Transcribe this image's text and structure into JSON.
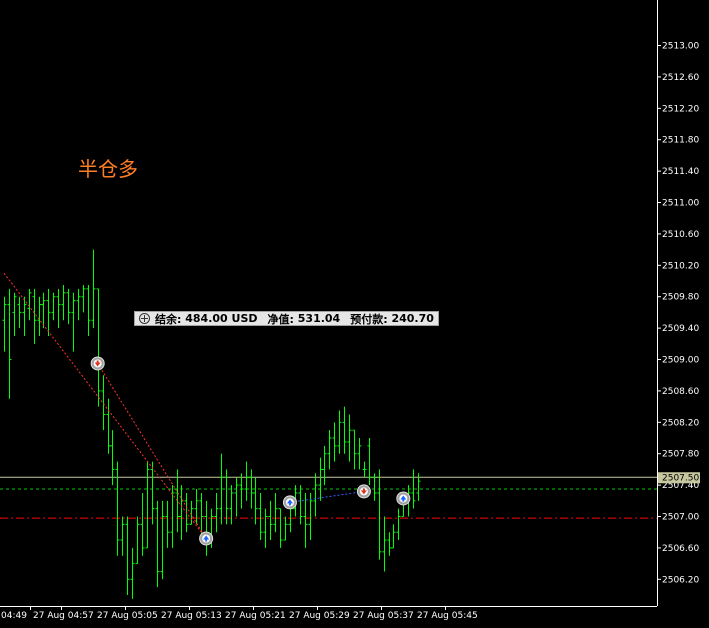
{
  "colors": {
    "background": "#000000",
    "axis": "#ffffff",
    "bar": "#00ff00",
    "bid_line": "#c8c8a0",
    "level_green": "#00c800",
    "level_red": "#ff0000",
    "trend_red": "#ff3030",
    "annotation": "#ff7f27",
    "price_tag_bg": "#c8c8a0"
  },
  "annotation_text": "半仓多",
  "account": {
    "balance_label": "结余:",
    "balance_value": "484.00 USD",
    "equity_label": "净值:",
    "equity_value": "531.04",
    "margin_label": "预付款:",
    "margin_value": "240.70"
  },
  "chart_data": {
    "type": "bar",
    "title": "",
    "xlabel": "",
    "ylabel": "",
    "ylim": [
      2505.86,
      2513.58
    ],
    "y_ticks": [
      "2513.00",
      "2512.60",
      "2512.20",
      "2511.80",
      "2511.40",
      "2511.00",
      "2510.60",
      "2510.20",
      "2509.80",
      "2509.40",
      "2509.00",
      "2508.60",
      "2508.20",
      "2507.80",
      "2507.40",
      "2507.00",
      "2506.60",
      "2506.20"
    ],
    "x_ticks": [
      "04:49",
      "27 Aug 04:57",
      "27 Aug 05:05",
      "27 Aug 05:13",
      "27 Aug 05:21",
      "27 Aug 05:29",
      "27 Aug 05:37",
      "27 Aug 05:45"
    ],
    "current_price": "2507.50",
    "level_lines": {
      "green_dashed": 2507.35,
      "red_dashdot": 2506.98
    },
    "bars": [
      [
        2509.8,
        2509.1,
        2509.5,
        2509.7
      ],
      [
        2509.9,
        2508.5,
        2509.7,
        2509.0
      ],
      [
        2509.85,
        2509.3,
        2509.6,
        2509.8
      ],
      [
        2509.8,
        2509.4,
        2509.7,
        2509.6
      ],
      [
        2509.8,
        2509.3,
        2509.6,
        2509.7
      ],
      [
        2509.9,
        2509.5,
        2509.65,
        2509.85
      ],
      [
        2509.9,
        2509.2,
        2509.8,
        2509.5
      ],
      [
        2509.8,
        2509.3,
        2509.5,
        2509.7
      ],
      [
        2509.85,
        2509.4,
        2509.7,
        2509.75
      ],
      [
        2509.9,
        2509.3,
        2509.75,
        2509.6
      ],
      [
        2509.85,
        2509.5,
        2509.6,
        2509.8
      ],
      [
        2509.9,
        2509.4,
        2509.8,
        2509.7
      ],
      [
        2509.95,
        2509.5,
        2509.7,
        2509.85
      ],
      [
        2509.9,
        2509.45,
        2509.85,
        2509.6
      ],
      [
        2509.85,
        2509.1,
        2509.6,
        2509.75
      ],
      [
        2509.9,
        2509.5,
        2509.75,
        2509.8
      ],
      [
        2509.95,
        2509.6,
        2509.8,
        2509.9
      ],
      [
        2509.95,
        2509.3,
        2509.9,
        2509.5
      ],
      [
        2510.4,
        2509.4,
        2509.5,
        2509.9
      ],
      [
        2509.9,
        2508.4,
        2509.9,
        2508.6
      ],
      [
        2508.8,
        2508.1,
        2508.6,
        2508.3
      ],
      [
        2508.5,
        2507.8,
        2508.3,
        2507.9
      ],
      [
        2508.1,
        2507.4,
        2507.9,
        2507.6
      ],
      [
        2507.7,
        2506.5,
        2507.6,
        2506.7
      ],
      [
        2507.0,
        2506.5,
        2506.7,
        2506.9
      ],
      [
        2507.0,
        2506.0,
        2506.9,
        2506.2
      ],
      [
        2506.6,
        2505.95,
        2506.2,
        2506.4
      ],
      [
        2507.0,
        2506.4,
        2506.4,
        2506.9
      ],
      [
        2507.3,
        2506.5,
        2506.9,
        2506.6
      ],
      [
        2507.7,
        2506.6,
        2506.6,
        2507.6
      ],
      [
        2507.7,
        2506.9,
        2507.6,
        2507.1
      ],
      [
        2507.2,
        2506.1,
        2507.1,
        2506.3
      ],
      [
        2507.2,
        2506.2,
        2506.3,
        2507.0
      ],
      [
        2507.2,
        2506.6,
        2507.0,
        2506.8
      ],
      [
        2507.4,
        2506.6,
        2506.8,
        2507.3
      ],
      [
        2507.6,
        2506.8,
        2507.3,
        2507.0
      ],
      [
        2507.4,
        2506.7,
        2507.0,
        2507.2
      ],
      [
        2507.3,
        2506.8,
        2507.2,
        2506.9
      ],
      [
        2507.2,
        2506.9,
        2506.9,
        2507.1
      ],
      [
        2507.35,
        2506.9,
        2507.1,
        2507.2
      ],
      [
        2507.3,
        2506.7,
        2507.2,
        2507.0
      ],
      [
        2507.2,
        2506.5,
        2507.0,
        2506.7
      ],
      [
        2507.1,
        2506.6,
        2506.7,
        2507.0
      ],
      [
        2507.3,
        2506.8,
        2507.0,
        2507.1
      ],
      [
        2507.8,
        2506.9,
        2507.1,
        2507.5
      ],
      [
        2507.6,
        2506.9,
        2507.5,
        2507.1
      ],
      [
        2507.4,
        2506.9,
        2507.1,
        2507.3
      ],
      [
        2507.5,
        2507.0,
        2507.3,
        2507.4
      ],
      [
        2507.55,
        2507.1,
        2507.4,
        2507.35
      ],
      [
        2507.7,
        2507.2,
        2507.35,
        2507.5
      ],
      [
        2507.6,
        2507.1,
        2507.5,
        2507.3
      ],
      [
        2507.5,
        2506.9,
        2507.3,
        2507.1
      ],
      [
        2507.3,
        2506.7,
        2507.1,
        2506.8
      ],
      [
        2507.1,
        2506.6,
        2506.8,
        2507.0
      ],
      [
        2507.2,
        2506.7,
        2507.0,
        2506.9
      ],
      [
        2507.3,
        2506.8,
        2506.9,
        2507.1
      ],
      [
        2507.1,
        2506.6,
        2507.1,
        2506.7
      ],
      [
        2507.0,
        2506.7,
        2506.7,
        2506.9
      ],
      [
        2507.2,
        2506.8,
        2506.9,
        2507.1
      ],
      [
        2507.4,
        2507.0,
        2507.1,
        2507.3
      ],
      [
        2507.4,
        2506.9,
        2507.3,
        2507.0
      ],
      [
        2507.3,
        2506.6,
        2507.0,
        2506.9
      ],
      [
        2507.3,
        2506.7,
        2506.9,
        2507.2
      ],
      [
        2507.55,
        2507.0,
        2507.2,
        2507.4
      ],
      [
        2507.75,
        2507.2,
        2507.4,
        2507.6
      ],
      [
        2507.9,
        2507.4,
        2507.6,
        2507.8
      ],
      [
        2508.1,
        2507.6,
        2507.8,
        2508.0
      ],
      [
        2508.2,
        2507.7,
        2508.0,
        2507.9
      ],
      [
        2508.35,
        2507.8,
        2507.9,
        2508.2
      ],
      [
        2508.4,
        2507.8,
        2508.2,
        2507.95
      ],
      [
        2508.3,
        2507.7,
        2507.95,
        2508.1
      ],
      [
        2508.1,
        2507.6,
        2508.1,
        2507.8
      ],
      [
        2508.0,
        2507.6,
        2507.8,
        2507.9
      ],
      [
        2507.7,
        2507.5,
        2507.6,
        2507.6
      ],
      [
        2508.0,
        2507.4,
        2507.9,
        2507.5
      ],
      [
        2507.55,
        2507.2,
        2507.5,
        2507.3
      ],
      [
        2507.6,
        2506.45,
        2507.3,
        2506.55
      ],
      [
        2507.0,
        2506.3,
        2506.55,
        2506.7
      ],
      [
        2506.8,
        2506.5,
        2506.7,
        2506.6
      ],
      [
        2506.9,
        2506.6,
        2506.6,
        2506.8
      ],
      [
        2507.1,
        2506.7,
        2506.8,
        2507.0
      ],
      [
        2507.3,
        2507.0,
        2507.0,
        2507.2
      ],
      [
        2507.4,
        2507.0,
        2507.2,
        2507.3
      ],
      [
        2507.6,
        2507.1,
        2507.3,
        2507.2
      ],
      [
        2507.55,
        2507.2,
        2507.3,
        2507.45
      ]
    ],
    "trade_markers": [
      {
        "type": "sell",
        "bar": 19,
        "price": 2508.95
      },
      {
        "type": "buy",
        "bar": 41,
        "price": 2506.72
      },
      {
        "type": "buy",
        "bar": 58,
        "price": 2507.18
      },
      {
        "type": "sell",
        "bar": 73,
        "price": 2507.32
      },
      {
        "type": "buy",
        "bar": 81,
        "price": 2507.23
      }
    ],
    "trade_lines": [
      {
        "from": [
          0,
          2510.1
        ],
        "to": [
          41,
          2506.72
        ],
        "color": "red"
      },
      {
        "from": [
          19,
          2508.95
        ],
        "to": [
          41,
          2506.72
        ],
        "color": "red"
      },
      {
        "from": [
          58,
          2507.18
        ],
        "to": [
          73,
          2507.32
        ],
        "color": "blue"
      }
    ]
  }
}
